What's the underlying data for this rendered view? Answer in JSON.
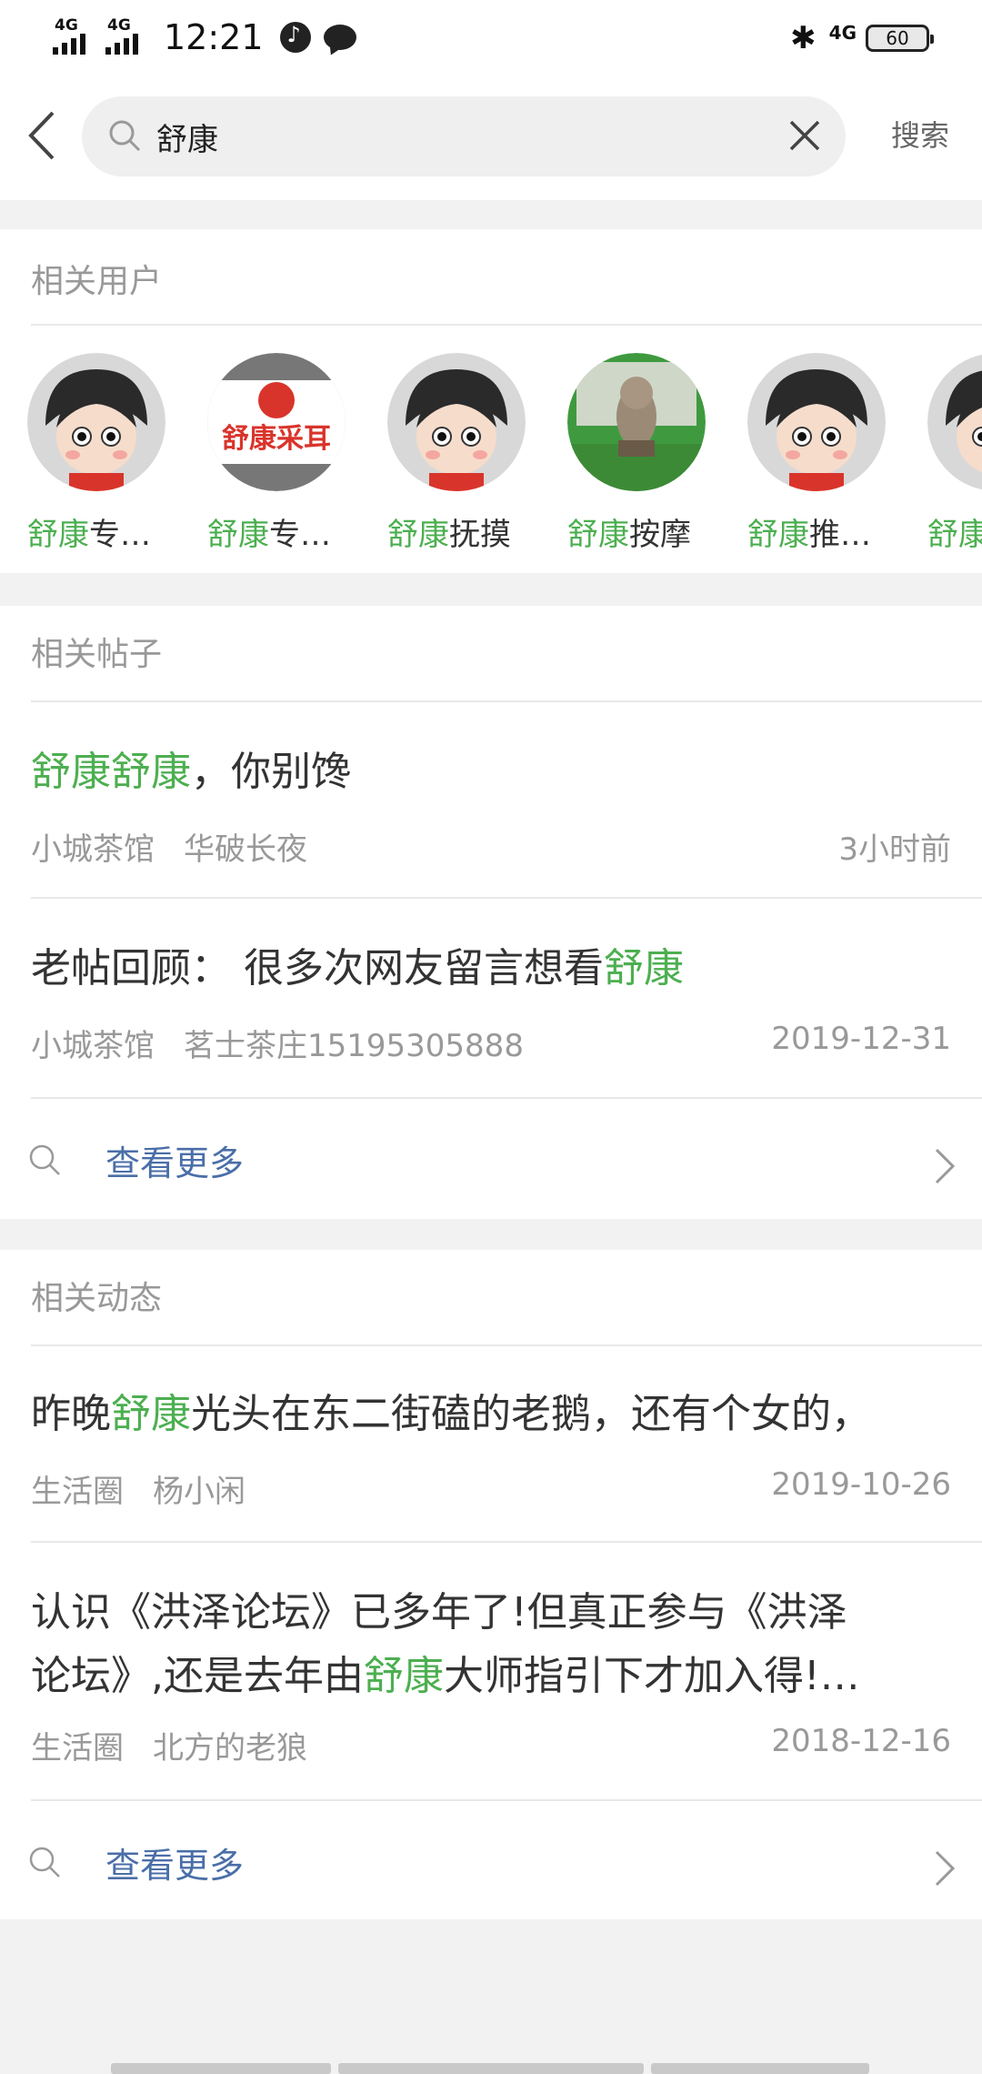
{
  "status_bar": {
    "signal1": "4G",
    "signal2": "4G",
    "time": "12:21",
    "net": "4G",
    "battery": "60"
  },
  "search": {
    "query": "舒康",
    "button_label": "搜索"
  },
  "users_section": {
    "title": "相关用户",
    "users": [
      {
        "highlight": "舒康",
        "rest": "专…",
        "avatar": "cartoon-girl"
      },
      {
        "highlight": "舒康",
        "rest": "专…",
        "avatar": "logo-舒康采耳",
        "logo_text": "舒康采耳"
      },
      {
        "highlight": "舒康",
        "rest": "抚摸",
        "avatar": "cartoon-girl"
      },
      {
        "highlight": "舒康",
        "rest": "按摩",
        "avatar": "photo-dog"
      },
      {
        "highlight": "舒康",
        "rest": "推…",
        "avatar": "cartoon-girl"
      },
      {
        "highlight": "舒康",
        "rest": "",
        "avatar": "cartoon-girl"
      }
    ]
  },
  "posts_section": {
    "title": "相关帖子",
    "posts": [
      {
        "pre": "",
        "highlight": "舒康舒康",
        "post": "，你别馋",
        "board": "小城茶馆",
        "author": "华破长夜",
        "date": "3小时前"
      },
      {
        "pre": "老帖回顾：  很多次网友留言想看",
        "highlight": "舒康",
        "post": "",
        "board": "小城茶馆",
        "author": "茗士茶庄15195305888",
        "date": "2019-12-31"
      }
    ],
    "more_label": "查看更多"
  },
  "feed_section": {
    "title": "相关动态",
    "items": [
      {
        "line1_pre": "昨晚",
        "line1_highlight": "舒康",
        "line1_post": "光头在东二街磕的老鹅，还有个女的，",
        "board": "生活圈",
        "author": "杨小闲",
        "date": "2019-10-26"
      },
      {
        "line1": "认识《洪泽论坛》已多年了!但真正参与《洪泽",
        "line2_pre": "论坛》,还是去年由",
        "line2_highlight": "舒康",
        "line2_post": "大师指引下才加入得!…",
        "board": "生活圈",
        "author": "北方的老狼",
        "date": "2018-12-16"
      }
    ],
    "more_label": "查看更多"
  },
  "colors": {
    "highlight": "#4caf50",
    "link": "#4a6ea8",
    "muted": "#999999",
    "background": "#f2f2f2"
  }
}
